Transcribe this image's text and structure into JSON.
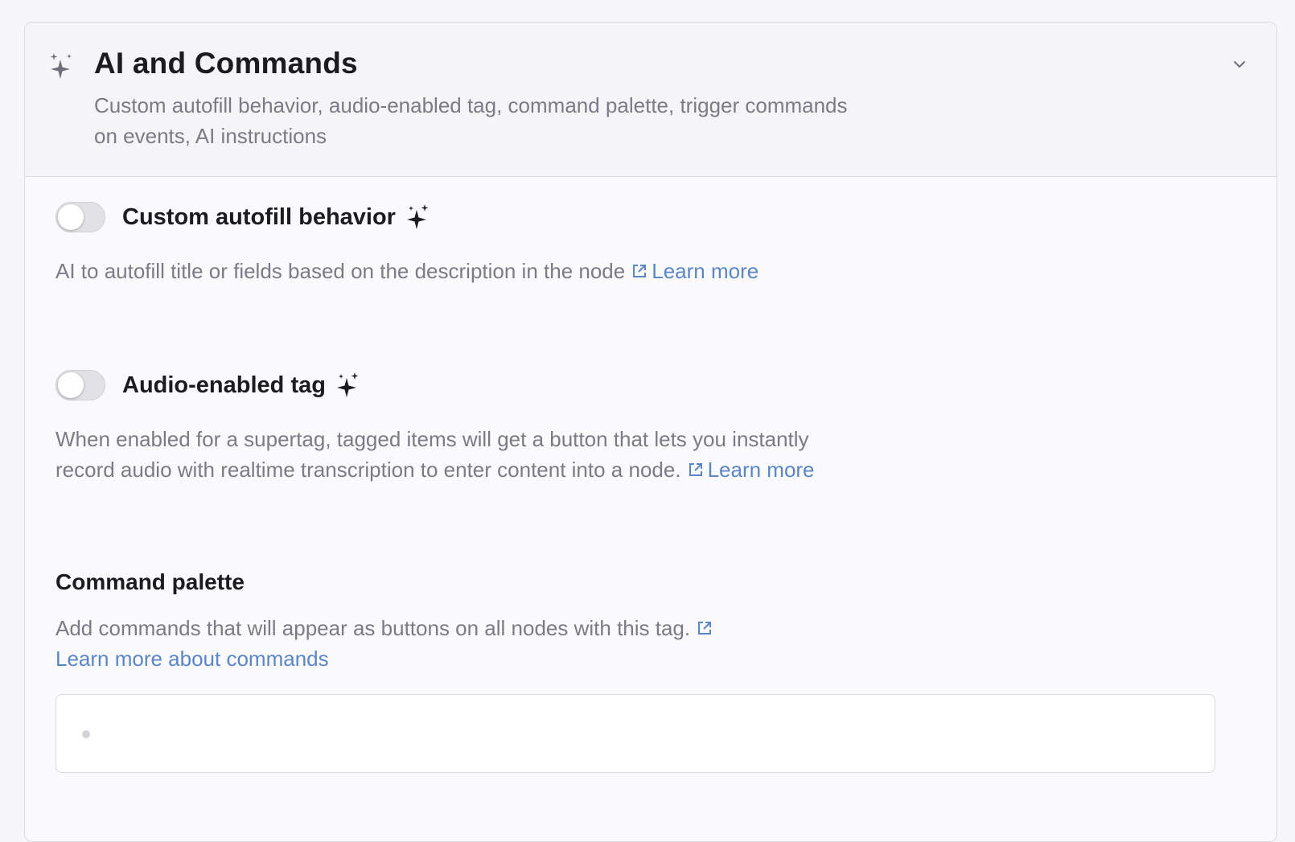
{
  "section": {
    "title": "AI and Commands",
    "description": "Custom autofill behavior, audio-enabled tag, command palette, trigger commands on events, AI instructions"
  },
  "autofill": {
    "label": "Custom autofill behavior",
    "enabled": false,
    "description": "AI to autofill title or fields based on the description in the node",
    "link": "Learn more"
  },
  "audio": {
    "label": "Audio-enabled tag",
    "enabled": false,
    "description": "When enabled for a supertag, tagged items will get a button that lets you instantly record audio with realtime transcription to enter content into a node.",
    "link": "Learn more"
  },
  "command_palette": {
    "title": "Command palette",
    "description": "Add commands that will appear as buttons on all nodes with this tag.",
    "link": "Learn more about commands"
  },
  "colors": {
    "accent_link": "#5b86c6",
    "muted_text": "#7b7b86",
    "heading_text": "#1c1c20"
  },
  "icons": {
    "header": "sparkles-icon",
    "collapse": "chevron-down-icon",
    "ai_badge": "sparkles-icon",
    "external": "external-link-icon"
  }
}
